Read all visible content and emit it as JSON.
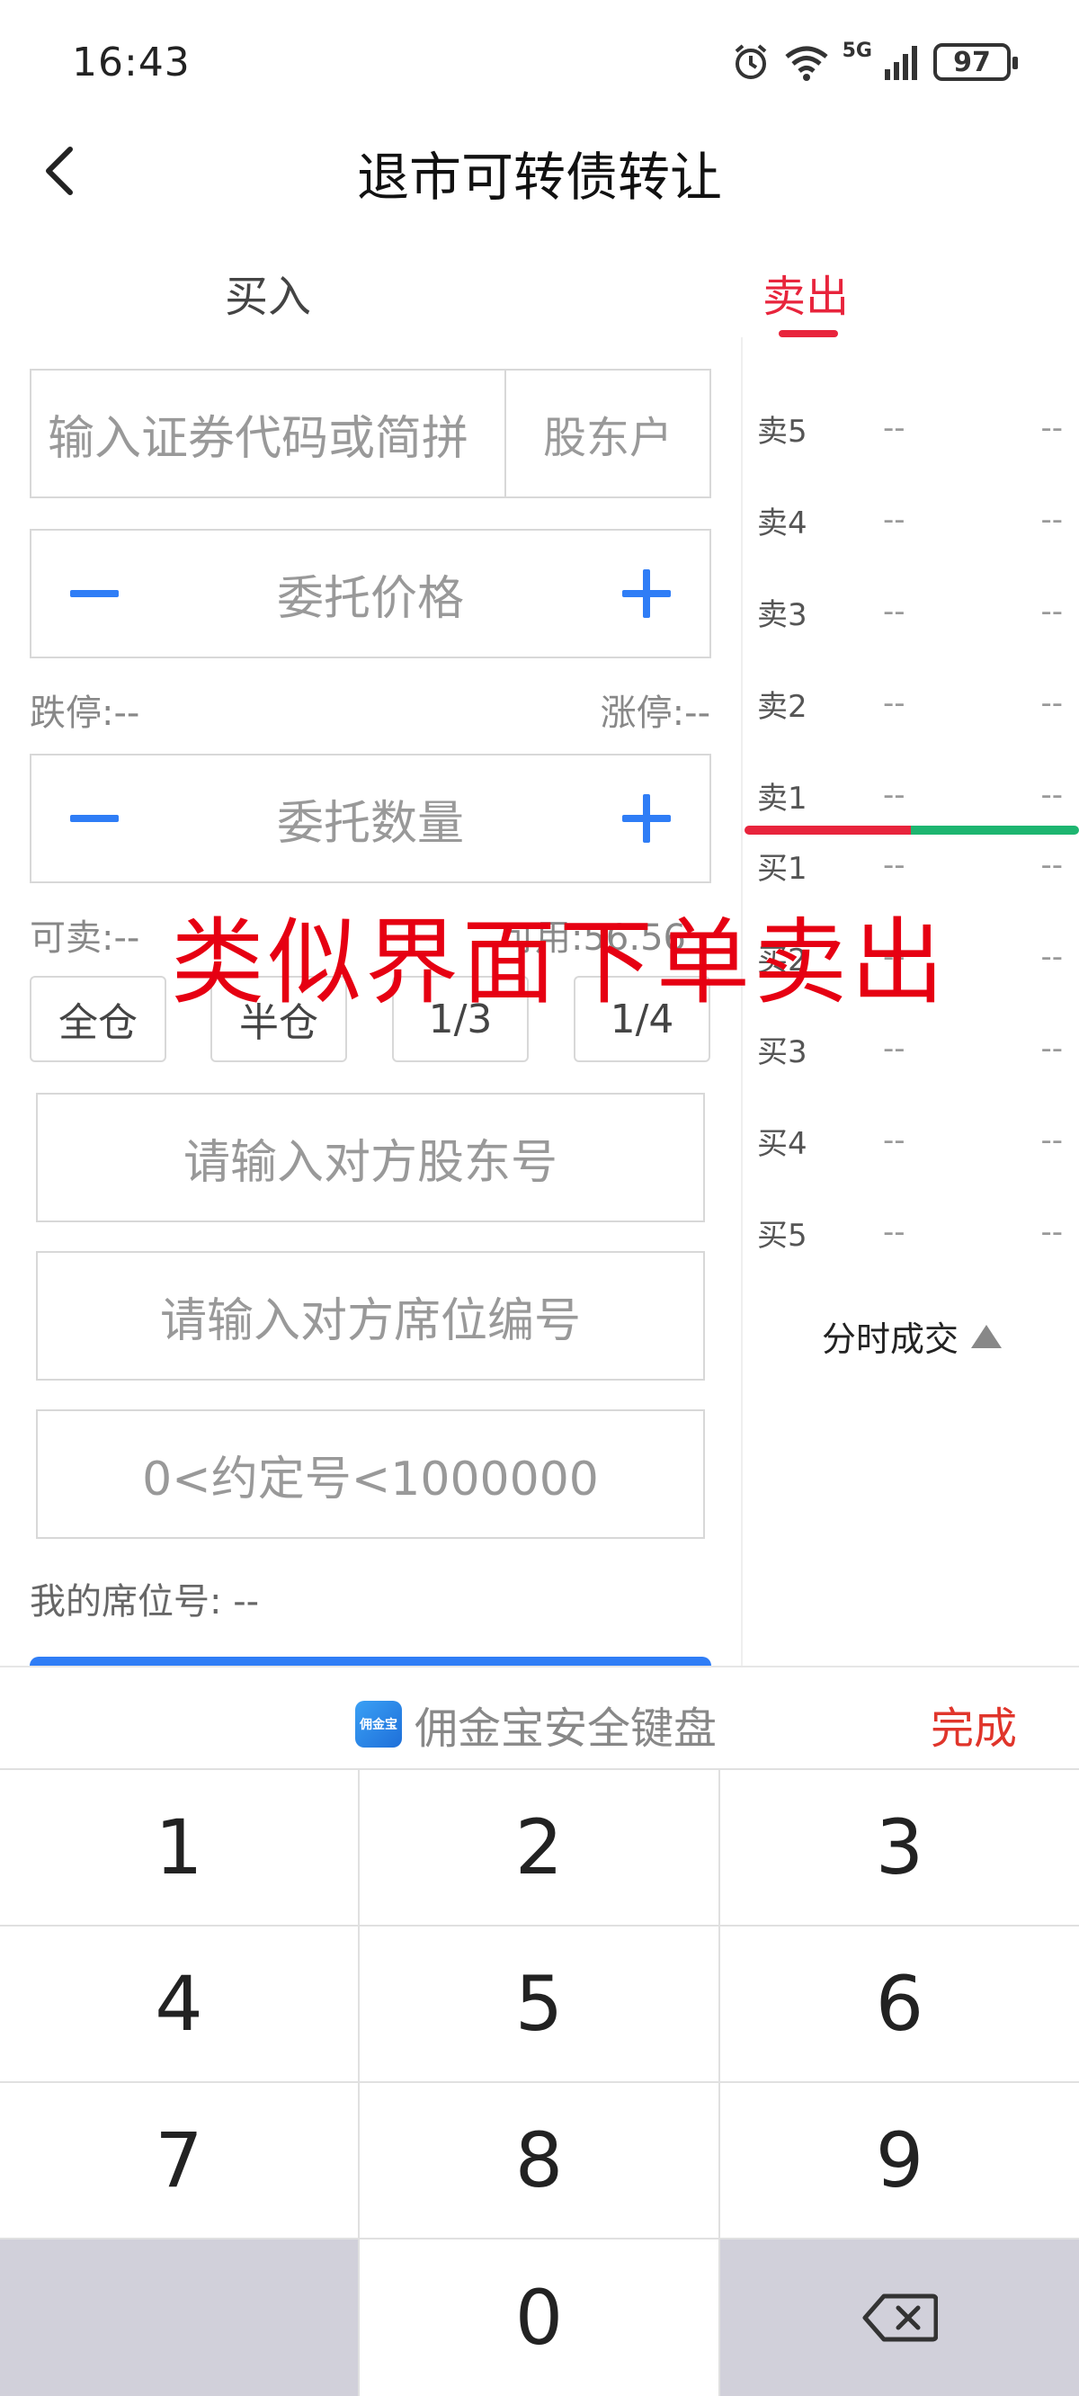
{
  "status_bar": {
    "time": "16:43",
    "signal_label": "5G",
    "battery": "97"
  },
  "header": {
    "title": "退市可转债转让"
  },
  "tabs": [
    {
      "label": "买入",
      "active": false
    },
    {
      "label": "卖出",
      "active": true
    }
  ],
  "form": {
    "code_placeholder": "输入证券代码或简拼",
    "account_label": "股东户",
    "price_placeholder": "委托价格",
    "limit_down": "跌停:--",
    "limit_up": "涨停:--",
    "qty_placeholder": "委托数量",
    "sellable": "可卖:--",
    "available": "可用:56.56",
    "fractions": [
      "全仓",
      "半仓",
      "1/3",
      "1/4"
    ],
    "counterparty_holder_placeholder": "请输入对方股东号",
    "counterparty_seat_placeholder": "请输入对方席位编号",
    "agreement_placeholder": "0<约定号<1000000",
    "my_seat": "我的席位号: --"
  },
  "overlay_note": "类似界面下单卖出",
  "order_book": {
    "asks": [
      {
        "label": "卖5",
        "price": "--",
        "volume": "--"
      },
      {
        "label": "卖4",
        "price": "--",
        "volume": "--"
      },
      {
        "label": "卖3",
        "price": "--",
        "volume": "--"
      },
      {
        "label": "卖2",
        "price": "--",
        "volume": "--"
      },
      {
        "label": "卖1",
        "price": "--",
        "volume": "--"
      }
    ],
    "bids": [
      {
        "label": "买1",
        "price": "--",
        "volume": "--"
      },
      {
        "label": "买2",
        "price": "--",
        "volume": "--"
      },
      {
        "label": "买3",
        "price": "--",
        "volume": "--"
      },
      {
        "label": "买4",
        "price": "--",
        "volume": "--"
      },
      {
        "label": "买5",
        "price": "--",
        "volume": "--"
      }
    ],
    "intraday_label": "分时成交"
  },
  "keyboard": {
    "logo_text": "佣金宝",
    "title": "佣金宝安全键盘",
    "done_label": "完成",
    "keys": [
      "1",
      "2",
      "3",
      "4",
      "5",
      "6",
      "7",
      "8",
      "9",
      "0"
    ]
  },
  "colors": {
    "accent_red": "#e8243c",
    "accent_blue": "#2f7df6",
    "bid_green": "#1db570",
    "overlay_red": "#e60012"
  }
}
